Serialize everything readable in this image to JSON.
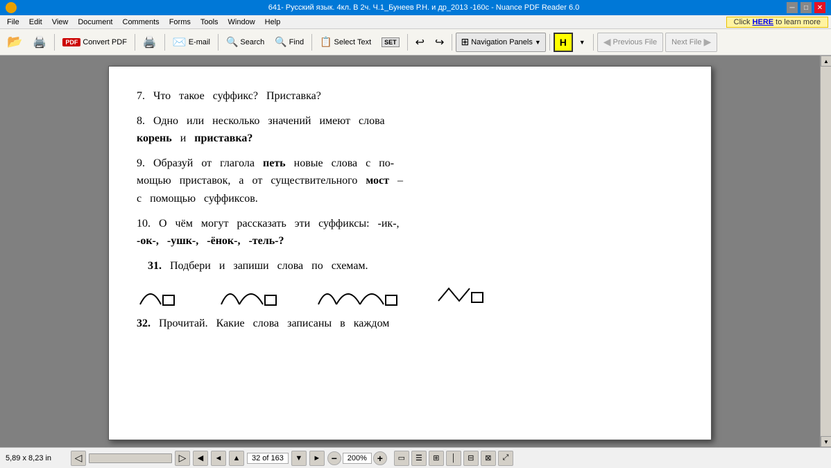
{
  "titlebar": {
    "title": "641- Русский язык. 4кл. В 2ч. Ч.1_Бунеев Р.Н. и др_2013 -160с - Nuance PDF Reader 6.0",
    "min_label": "─",
    "max_label": "□",
    "close_label": "✕"
  },
  "menubar": {
    "items": [
      "File",
      "Edit",
      "View",
      "Document",
      "Comments",
      "Forms",
      "Tools",
      "Window",
      "Help"
    ]
  },
  "toolbar": {
    "open_label": "",
    "convert_label": "Convert PDF",
    "print_label": "",
    "email_label": "E-mail",
    "search_label": "Search",
    "find_label": "Find",
    "select_text_label": "Select Text",
    "nav_panels_label": "Navigation Panels",
    "highlight_label": "H",
    "prev_file_label": "Previous File",
    "next_file_label": "Next File"
  },
  "ad_banner": {
    "text_before": "Click ",
    "here_label": "HERE",
    "text_after": " to learn more"
  },
  "pdf": {
    "content": [
      {
        "id": "item7",
        "text": "7.  Что  такое  суффикс?  Приставка?"
      },
      {
        "id": "item8",
        "text": "8.  Одно  или  несколько  значений  имеют  слова  "
      },
      {
        "id": "item8b",
        "bold_parts": [
          "корень",
          " и ",
          "приставка?"
        ]
      },
      {
        "id": "item9",
        "text": "9.  Образуй  от  глагола  "
      },
      {
        "id": "item9b",
        "text": " новые  слова  с  по-мощью  приставок,  а  от  существительного  "
      },
      {
        "id": "item9c",
        "text": "мост"
      },
      {
        "id": "item9d",
        "text": "  –  с  помощью  суффиксов."
      },
      {
        "id": "item10",
        "text": "10.  О  чём  могут  рассказать  эти  суффиксы:  -ик-,"
      },
      {
        "id": "item10b",
        "text": "-ок-,  -ушк-,  -ёнок-,  -тель-?"
      },
      {
        "id": "item31",
        "text": "31.  Подбери  и  запиши  слова  по  схемам."
      },
      {
        "id": "item32",
        "text": "32.  Прочитай.  Какие  слова  записаны  в  каждом"
      }
    ]
  },
  "statusbar": {
    "dimensions": "5,89 x 8,23 in",
    "page_info": "32 of 163",
    "zoom": "200%",
    "nav": {
      "prev_label": "◄",
      "next_label": "►",
      "up_label": "▲",
      "down_label": "▼"
    }
  }
}
